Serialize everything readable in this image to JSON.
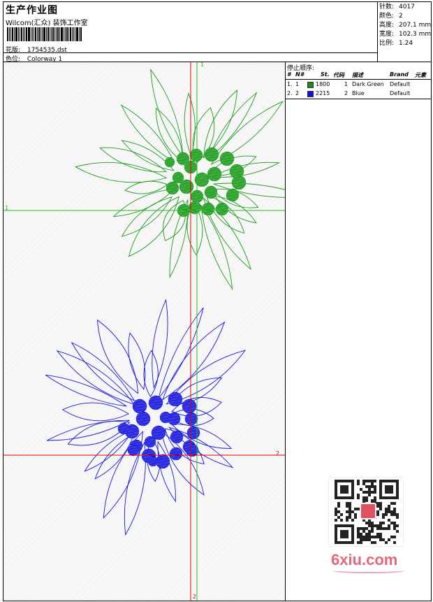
{
  "header": {
    "title": "生产作业图",
    "company": "Wilcom(汇众) 装饰工作室",
    "file_label": "花版:",
    "file_name": "1754535.dst",
    "colorway_label": "色位:",
    "colorway": "Colorway 1"
  },
  "stats": [
    {
      "label": "针数:",
      "value": "4017"
    },
    {
      "label": "颜色:",
      "value": "2"
    },
    {
      "label": "高度:",
      "value": "207.1 mm"
    },
    {
      "label": "宽度:",
      "value": "102.3 mm"
    },
    {
      "label": "比例:",
      "value": "1.24"
    }
  ],
  "design": {
    "markers": {
      "green_top": "1",
      "green_left": "1",
      "red_bottom": "2",
      "red_right": "2"
    },
    "thread_colors": {
      "green": "#1a9a1a",
      "blue": "#1414e0",
      "red_axis": "#e00000",
      "green_axis": "#20c020"
    }
  },
  "sequence": {
    "title": "停止顺序:",
    "columns": [
      "#",
      "N#",
      "St.",
      "代码",
      "描述",
      "Brand",
      "元素"
    ],
    "rows": [
      {
        "num": "1.",
        "n": "1",
        "color": "#1a8c1a",
        "stitches": "1800",
        "code": "1",
        "desc": "Dark Green",
        "brand": "Default"
      },
      {
        "num": "2.",
        "n": "2",
        "color": "#1010e0",
        "stitches": "2215",
        "code": "2",
        "desc": "Blue",
        "brand": "Default"
      }
    ]
  },
  "watermark": {
    "logo": "6xiu.com"
  }
}
